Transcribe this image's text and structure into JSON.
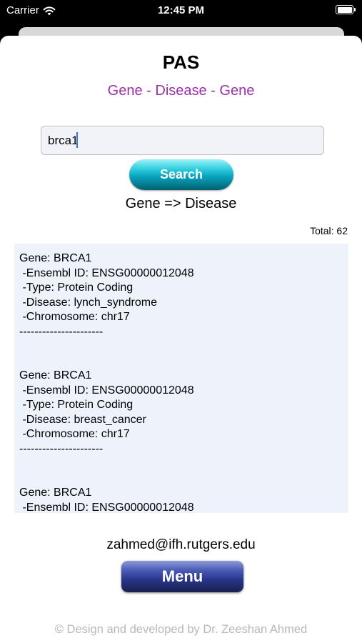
{
  "status_bar": {
    "carrier": "Carrier",
    "time": "12:45 PM",
    "battery_level": 1.0
  },
  "header": {
    "title": "PAS",
    "subtitle": "Gene - Disease - Gene",
    "subtitle_color": "#9b30a8"
  },
  "search": {
    "value": "brca1",
    "button_label": "Search"
  },
  "mode_label": "Gene => Disease",
  "total_label": "Total: 62",
  "results": [
    {
      "gene": "Gene: BRCA1",
      "ensembl": " -Ensembl ID: ENSG00000012048",
      "type": " -Type: Protein Coding",
      "disease": " -Disease: lynch_syndrome",
      "chromosome": " -Chromosome: chr17",
      "separator": "----------------------"
    },
    {
      "gene": "Gene: BRCA1",
      "ensembl": " -Ensembl ID: ENSG00000012048",
      "type": " -Type: Protein Coding",
      "disease": " -Disease: breast_cancer",
      "chromosome": " -Chromosome: chr17",
      "separator": "----------------------"
    },
    {
      "gene": "Gene: BRCA1",
      "ensembl": " -Ensembl ID: ENSG00000012048"
    }
  ],
  "contact_email": "zahmed@ifh.rutgers.edu",
  "menu_label": "Menu",
  "footer": "© Design and developed by Dr. Zeeshan Ahmed"
}
